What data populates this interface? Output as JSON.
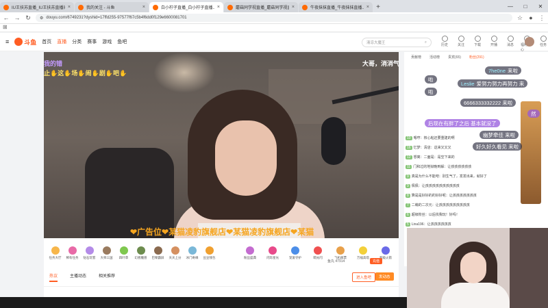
{
  "tabs": [
    {
      "title": "IU王扶苏直播_IU王扶苏直播间_...",
      "close": "×"
    },
    {
      "title": "我的关注 - 斗鱼",
      "close": "×"
    },
    {
      "title": "白小柠子直播_白小柠子直播...",
      "close": "×"
    },
    {
      "title": "蘑菇同学视直播_蘑菇同学视直...",
      "close": "×"
    },
    {
      "title": "牛夜抹抹直播_牛夜抹抹直播...",
      "close": "×"
    }
  ],
  "new_tab": "+",
  "window_buttons": {
    "min": "—",
    "max": "□",
    "close": "✕"
  },
  "url": "douyu.com/6749231?dyshid=17ffd255-97577f67c5b4f6dd0f129e6600081701",
  "nav": {
    "brand": "斗鱼",
    "items": [
      "首页",
      "直播",
      "分类",
      "赛事",
      "游戏",
      "鱼吧"
    ],
    "active": 1
  },
  "search": {
    "placeholder": "清凉大魔王",
    "icon": "search-icon"
  },
  "tool_icons": [
    "历史",
    "关注",
    "下载",
    "开播",
    "消息",
    "福利中心",
    "任务"
  ],
  "danmu": [
    {
      "text": "我的错",
      "color": "#c49bff"
    },
    {
      "text": "止✋这✋场✋闹✋剧✋吧✋",
      "color": "#ffe36b"
    },
    {
      "text": "大哥，消消气",
      "color": "#ffffff"
    }
  ],
  "overlay_text": "❤广告位❤某猫凌豹旗舰店❤某猫凌豹旗舰店❤某猫",
  "gift_bar": {
    "gifts": [
      {
        "name": "任务大厅",
        "color": "#f7b64a"
      },
      {
        "name": "稀有任务",
        "color": "#e86aa7"
      },
      {
        "name": "钻石玩客",
        "color": "#b48be8"
      },
      {
        "name": "大师三国",
        "color": "#9a7b5f"
      },
      {
        "name": "四叶草",
        "color": "#7fc84f"
      },
      {
        "name": "幻想魔兽",
        "color": "#6d8c4e"
      },
      {
        "name": "巴黎霸屏",
        "color": "#8a6a4f"
      },
      {
        "name": "天天上分",
        "color": "#d59060"
      },
      {
        "name": "冰门奇缘",
        "color": "#7ab8d8"
      },
      {
        "name": "豆豆钱包",
        "color": "#f0a030"
      }
    ],
    "right": [
      {
        "name": "粉丝盛典",
        "color": "#c46cd0"
      },
      {
        "name": "闪烁星光",
        "color": "#e84a8a"
      },
      {
        "name": "宠爱守护",
        "color": "#4c8ee8"
      },
      {
        "name": "萌光闪",
        "color": "#f05050"
      },
      {
        "name": "飞机邮票",
        "color": "#e8a04a"
      },
      {
        "name": "万福高塔",
        "color": "#f3d03a"
      },
      {
        "name": "超级火箭",
        "color": "#6a6ae8"
      }
    ],
    "balance": "鱼丸 47914",
    "recharge": "充值"
  },
  "under_tabs": [
    "热议",
    "主播动态",
    "相关推荐"
  ],
  "under_buttons": {
    "enter_bar": "进入鱼吧",
    "post": "发动态"
  },
  "side_tabs": [
    "贡献榜",
    "活动榜",
    "贵宾(65)",
    "粉丝(291)"
  ],
  "chat": [
    {
      "lv": "10",
      "text": "嗯哼：核心粘还要重建的啊"
    },
    {
      "lv": "16",
      "text": "忆梦：清店：这来又又又"
    },
    {
      "lv": "12",
      "text": "想离：二面是：是空下来的"
    },
    {
      "lv": "11",
      "text": "门和过的地狱晚到解：让孩孩孩孩孩孩"
    },
    {
      "lv": "9",
      "text": "真是为什么不能吧：别生气了，发发出来，就好了"
    },
    {
      "lv": "9",
      "text": "佩佩：让孩孩孩孩孩孩孩孩孩孩"
    },
    {
      "lv": "8",
      "text": "算是是好好的的好好呢：让孩孩孩孩孩孩孩"
    },
    {
      "lv": "7",
      "text": "二萌的二次元：让孩孩孩孩孩孩孩孩孩"
    },
    {
      "lv": "6",
      "text": "超级粉丝：以后找我玩！好吗！"
    },
    {
      "lv": "5",
      "text": "Lina196：让孩孩孩孩孩孩"
    }
  ],
  "bubbles": [
    {
      "name": "7he0ne",
      "msg": "来啦"
    },
    {
      "name": "",
      "msg": "啦"
    },
    {
      "name": "Leslie",
      "msg": "爱努力努力再努力 来"
    },
    {
      "name": "",
      "msg": "啦"
    },
    {
      "name": "",
      "msg": "6666333332222 来啦"
    },
    {
      "name": "",
      "msg": "然"
    },
    {
      "name": "",
      "msg": "后现在有胖了之后 基本就没了"
    },
    {
      "name": "",
      "msg": "幽梦牵佳 来啦"
    },
    {
      "name": "",
      "msg": "好久好久看见 来啦"
    }
  ]
}
